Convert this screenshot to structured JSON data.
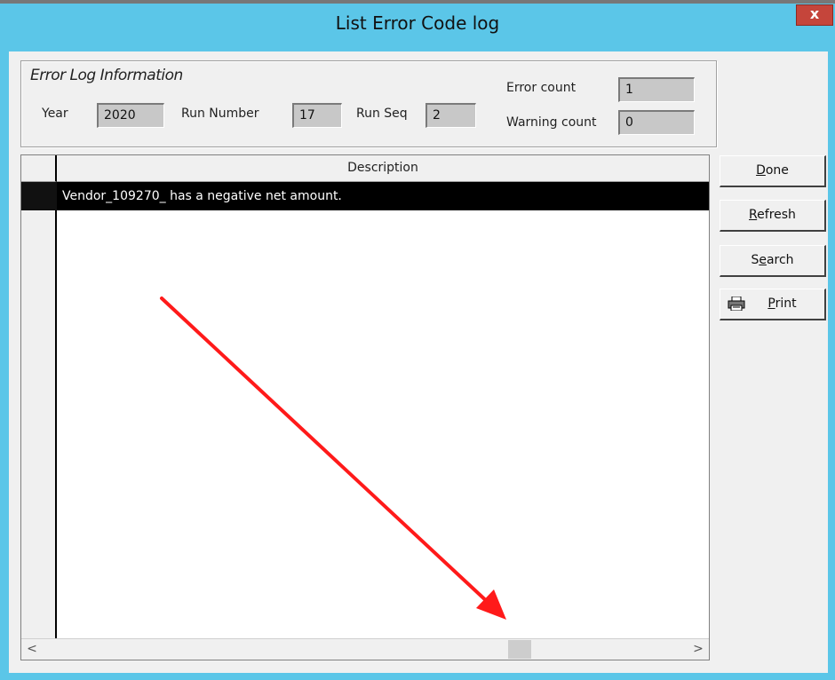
{
  "window": {
    "title": "List Error Code log",
    "close_label": "x"
  },
  "group": {
    "title": "Error Log Information",
    "year_label": "Year",
    "year_value": "2020",
    "run_number_label": "Run Number",
    "run_number_value": "17",
    "run_seq_label": "Run Seq",
    "run_seq_value": "2",
    "error_count_label": "Error count",
    "error_count_value": "1",
    "warning_count_label": "Warning count",
    "warning_count_value": "0"
  },
  "grid": {
    "column_header": "Description",
    "rows": [
      {
        "description": "Vendor_109270_ has a negative net amount."
      }
    ],
    "scroll_left": "<",
    "scroll_right": ">"
  },
  "buttons": {
    "done": {
      "mnemonic": "D",
      "rest": "one"
    },
    "refresh": {
      "mnemonic": "R",
      "rest": "efresh"
    },
    "search": {
      "pre": "S",
      "mnemonic": "e",
      "rest": "arch"
    },
    "print": {
      "mnemonic": "P",
      "rest": "rint"
    }
  },
  "annotation": {
    "arrow_color": "#ff1a1a",
    "icon": "arrow-annotation"
  },
  "colors": {
    "titlebar": "#5bc6e8",
    "close_button": "#c5453b",
    "selection": "#000000"
  }
}
